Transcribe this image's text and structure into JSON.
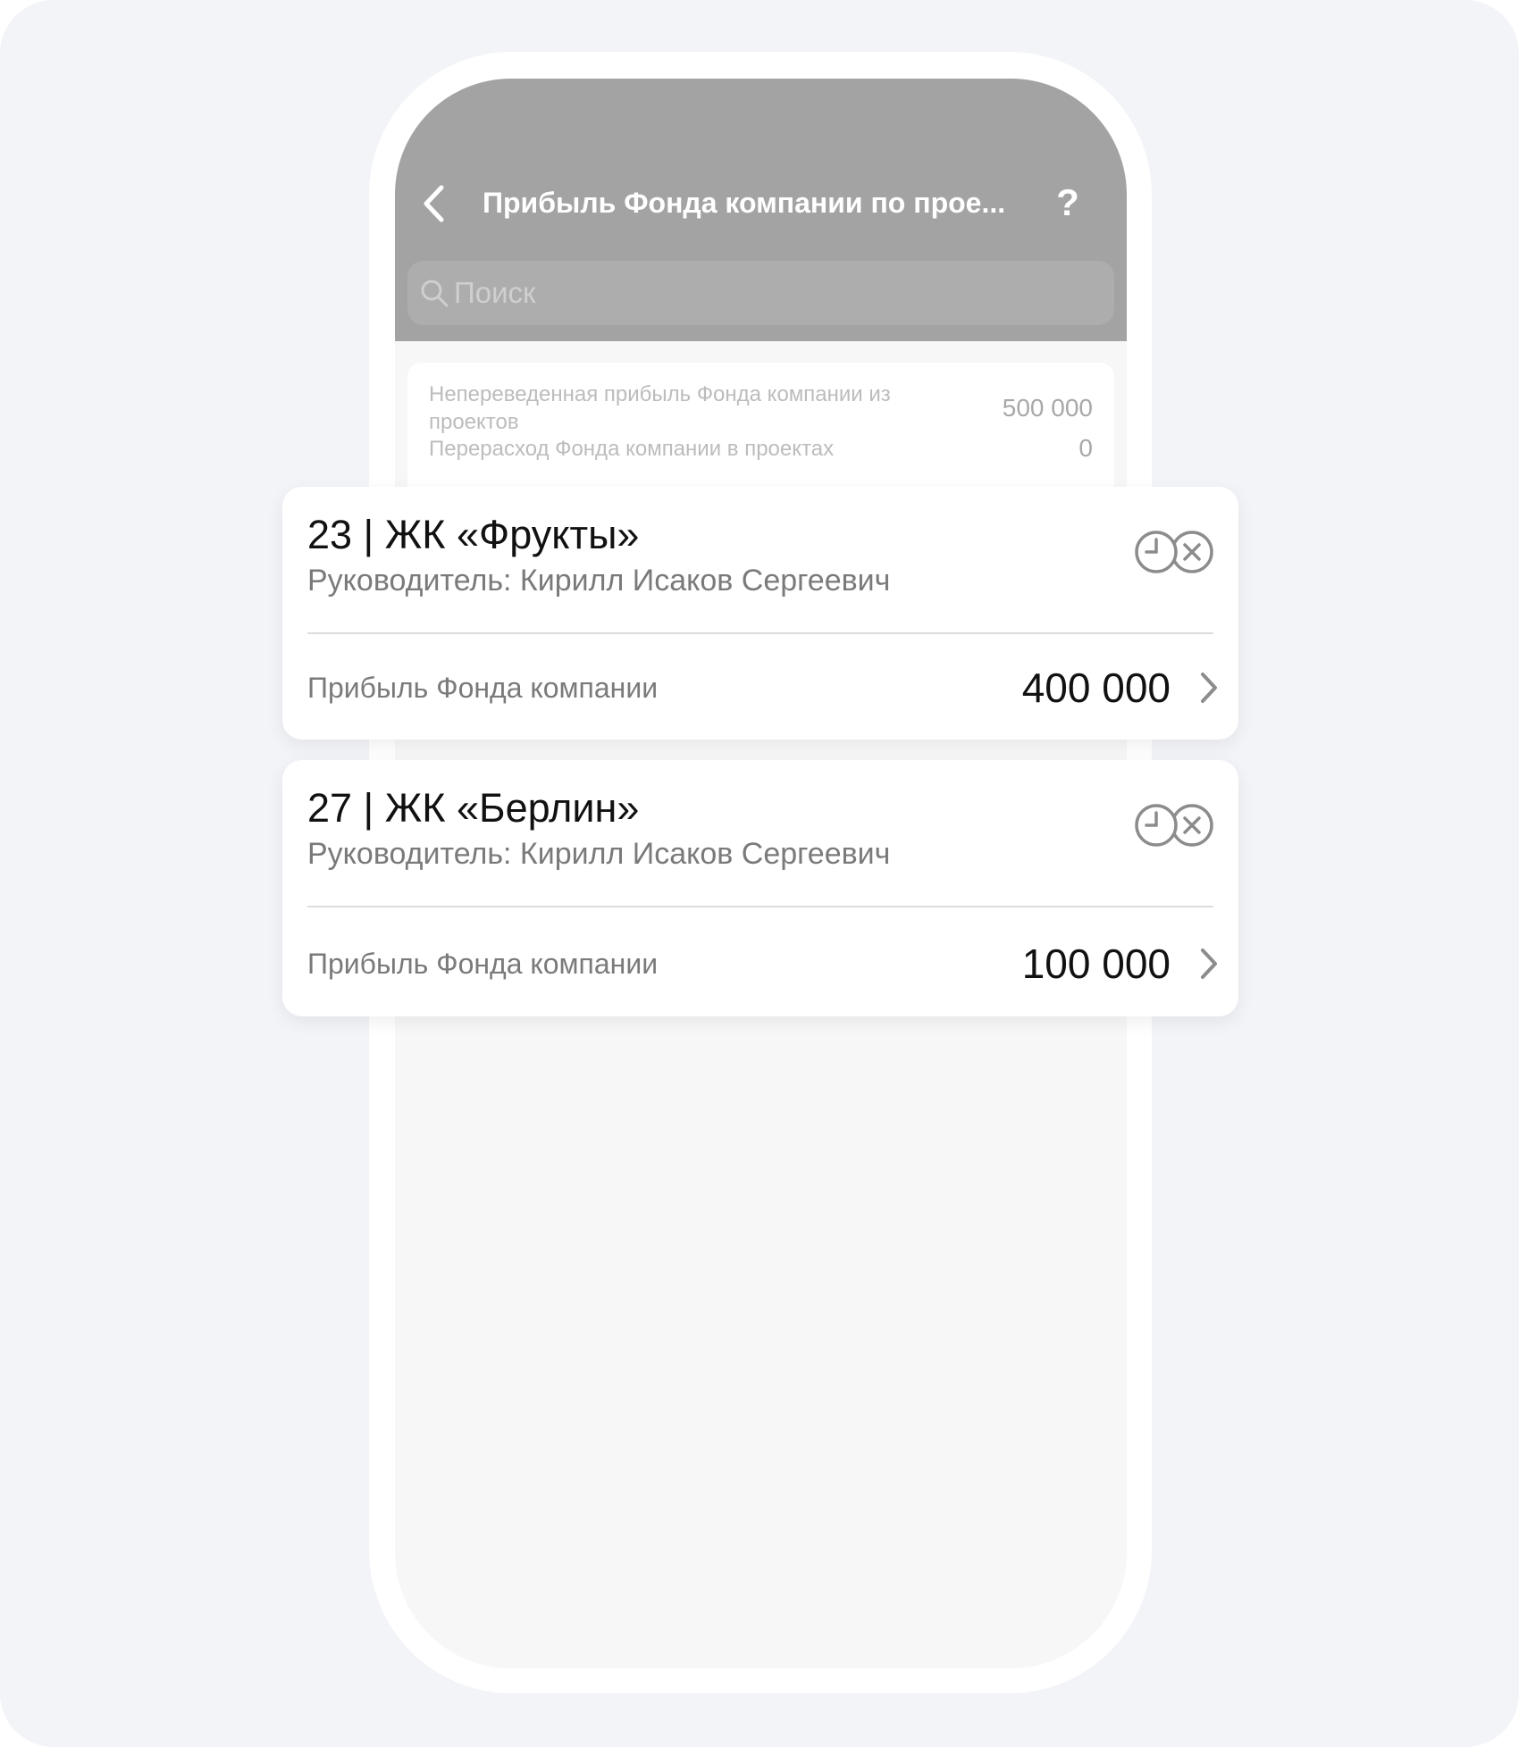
{
  "header": {
    "title": "Прибыль Фонда компании по прое...",
    "help_label": "?"
  },
  "search": {
    "placeholder": "Поиск"
  },
  "summary": {
    "rows": [
      {
        "label": "Непереведенная прибыль Фонда компании из проектов",
        "value": "500 000"
      },
      {
        "label": "Перерасход Фонда компании в проектах",
        "value": "0"
      }
    ]
  },
  "projects": [
    {
      "title": "23 | ЖК «Фрукты»",
      "manager": "Руководитель: Кирилл Исаков Сергеевич",
      "profit_label": "Прибыль Фонда компании",
      "profit_value": "400 000"
    },
    {
      "title": "27 | ЖК «Берлин»",
      "manager": "Руководитель: Кирилл Исаков Сергеевич",
      "profit_label": "Прибыль Фонда компании",
      "profit_value": "100 000"
    }
  ],
  "icons": {
    "back": "chevron-left-icon",
    "search": "search-icon",
    "status": "clock-cancel-icon",
    "row_arrow": "chevron-right-icon"
  },
  "colors": {
    "header_bg": "#a3a3a3",
    "card_bg": "#ffffff",
    "page_bg": "#f3f4f8",
    "icon_gray": "#8c8c8c"
  }
}
